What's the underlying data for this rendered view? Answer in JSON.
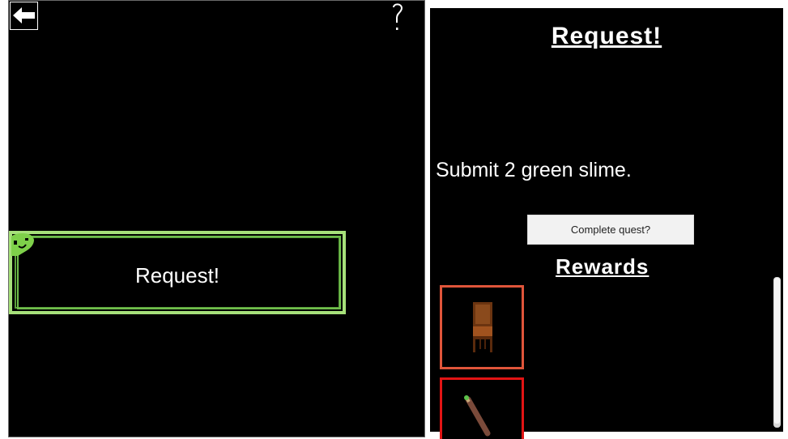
{
  "left_panel": {
    "back_icon": "arrow-left-icon",
    "help_icon": "question-mark-icon",
    "request_card": {
      "label": "Request!",
      "icon": "green-slime-icon",
      "border_color": "#a6e07a"
    }
  },
  "quest_panel": {
    "title": "Request!",
    "description": "Submit 2 green slime.",
    "complete_button_label": "Complete quest?",
    "rewards_title": "Rewards",
    "rewards": [
      {
        "icon": "wooden-chair-icon",
        "border_color": "#e0553a"
      },
      {
        "icon": "paintbrush-icon",
        "border_color": "#e21414"
      }
    ]
  }
}
